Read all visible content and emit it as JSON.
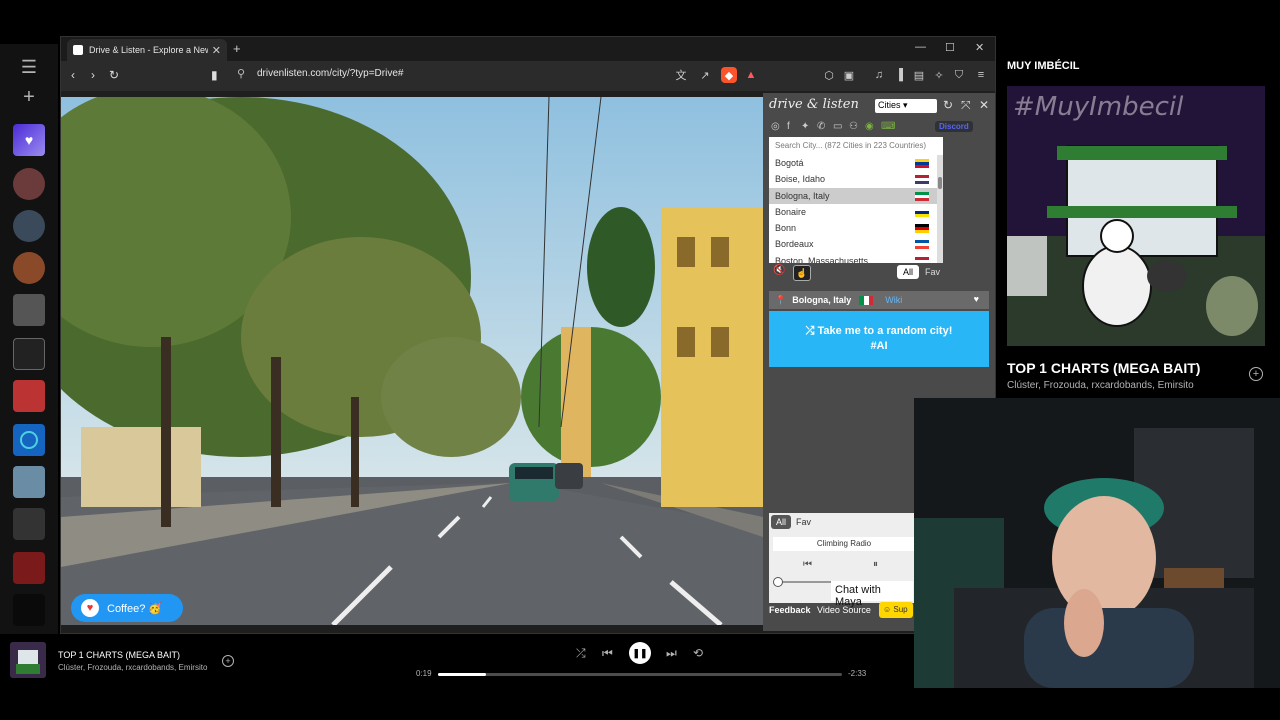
{
  "browser": {
    "tab_title": "Drive & Listen - Explore a New C",
    "new_tab": "+",
    "url": "drivenlisten.com/city/?typ=Drive#"
  },
  "extension": {
    "logo": "drive & listen",
    "mode_select": "Cities",
    "discord": "Discord",
    "search_placeholder": "Search City... (872 Cities in 223 Countries)",
    "cities": [
      {
        "name": "Bogotá",
        "flag_colors": [
          "#fcd116",
          "#003893",
          "#ce1126"
        ]
      },
      {
        "name": "Boise, Idaho",
        "flag_colors": [
          "#b22234",
          "#ffffff",
          "#3c3b6e"
        ]
      },
      {
        "name": "Bologna, Italy",
        "flag_colors": [
          "#009246",
          "#ffffff",
          "#ce2b37"
        ]
      },
      {
        "name": "Bonaire",
        "flag_colors": [
          "#ffffff",
          "#012a87",
          "#f9e300"
        ]
      },
      {
        "name": "Bonn",
        "flag_colors": [
          "#000000",
          "#dd0000",
          "#ffce00"
        ]
      },
      {
        "name": "Bordeaux",
        "flag_colors": [
          "#0055a4",
          "#ffffff",
          "#ef4135"
        ]
      },
      {
        "name": "Boston, Massachusetts",
        "flag_colors": [
          "#b22234",
          "#ffffff",
          "#3c3b6e"
        ]
      }
    ],
    "selected_city_index": 2,
    "filter_all": "All",
    "filter_fav": "Fav",
    "current_location": "Bologna, Italy",
    "wiki": "Wiki",
    "random_line1": "Take me to a random city!",
    "random_line2": "#AI",
    "radio": {
      "tab_all": "All",
      "tab_fav": "Fav",
      "station": "Climbing Radio"
    },
    "chat": "Chat with Maya",
    "feedback": "Feedback",
    "video_source": "Video Source",
    "support": "Sup"
  },
  "coffee": "Coffee? 🥳",
  "spotify": {
    "header": "MUY IMBÉCIL",
    "art_text": "#MuyImbecil",
    "title": "TOP 1 CHARTS (MEGA BAIT)",
    "artists": "Clúster, Frozouda, rxcardobands, Emirsito"
  },
  "player": {
    "title": "TOP 1 CHARTS (MEGA BAIT)",
    "artists": "Clúster, Frozouda, rxcardobands, Emirsito",
    "elapsed": "0:19",
    "remaining": "-2:33",
    "progress_fraction": 0.12
  },
  "colors": {
    "accent_blue": "#29b6f6",
    "spotify_green": "#1db954",
    "coffee_blue": "#2196f3"
  }
}
